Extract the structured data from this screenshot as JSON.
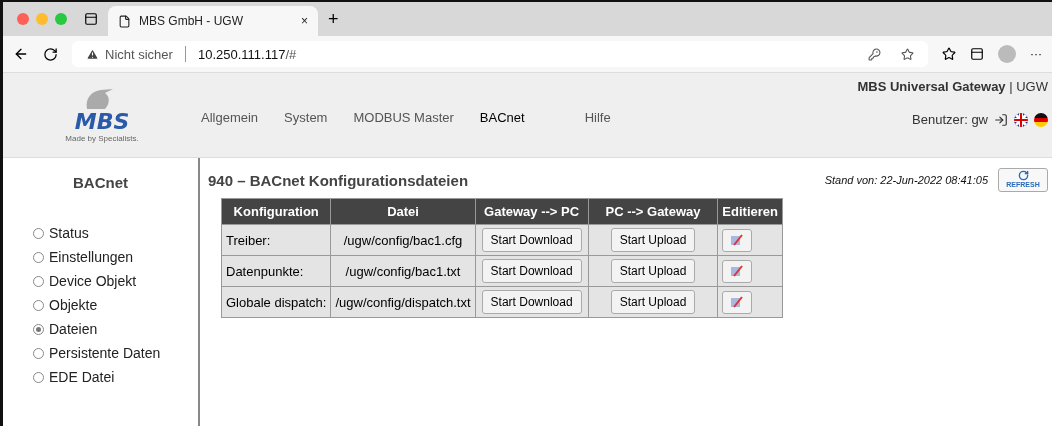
{
  "browser": {
    "tab": {
      "title": "MBS GmbH - UGW",
      "close": "×"
    },
    "new_tab": "+",
    "security": "Nicht sicher",
    "url_host": "10.250.111.117",
    "url_path": "/#",
    "more": "···"
  },
  "header": {
    "logo_text": "MBS",
    "logo_tagline": "Made by Specialists.",
    "product": "MBS Universal Gateway",
    "product_suffix": "| UGW",
    "user_label": "Benutzer:",
    "user": "gw",
    "nav": [
      {
        "label": "Allgemein",
        "selected": false
      },
      {
        "label": "System",
        "selected": false
      },
      {
        "label": "MODBUS Master",
        "selected": false
      },
      {
        "label": "BACnet",
        "selected": true
      },
      {
        "label": "Hilfe",
        "selected": false
      }
    ]
  },
  "sidebar": {
    "title": "BACnet",
    "items": [
      {
        "label": "Status",
        "selected": false
      },
      {
        "label": "Einstellungen",
        "selected": false
      },
      {
        "label": "Device Objekt",
        "selected": false
      },
      {
        "label": "Objekte",
        "selected": false
      },
      {
        "label": "Dateien",
        "selected": true
      },
      {
        "label": "Persistente Daten",
        "selected": false
      },
      {
        "label": "EDE Datei",
        "selected": false
      }
    ]
  },
  "content": {
    "title": "940 – BACnet Konfigurationsdateien",
    "stand": "Stand von: 22-Jun-2022 08:41:05",
    "refresh": "REFRESH",
    "table": {
      "columns": [
        "Konfiguration",
        "Datei",
        "Gateway --> PC",
        "PC --> Gateway",
        "Editieren"
      ],
      "rows": [
        {
          "name": "Treiber:",
          "file": "/ugw/config/bac1.cfg",
          "download": "Start Download",
          "upload": "Start Upload"
        },
        {
          "name": "Datenpunkte:",
          "file": "/ugw/config/bac1.txt",
          "download": "Start Download",
          "upload": "Start Upload"
        },
        {
          "name": "Globale dispatch:",
          "file": "/ugw/config/dispatch.txt",
          "download": "Start Download",
          "upload": "Start Upload"
        }
      ]
    }
  }
}
